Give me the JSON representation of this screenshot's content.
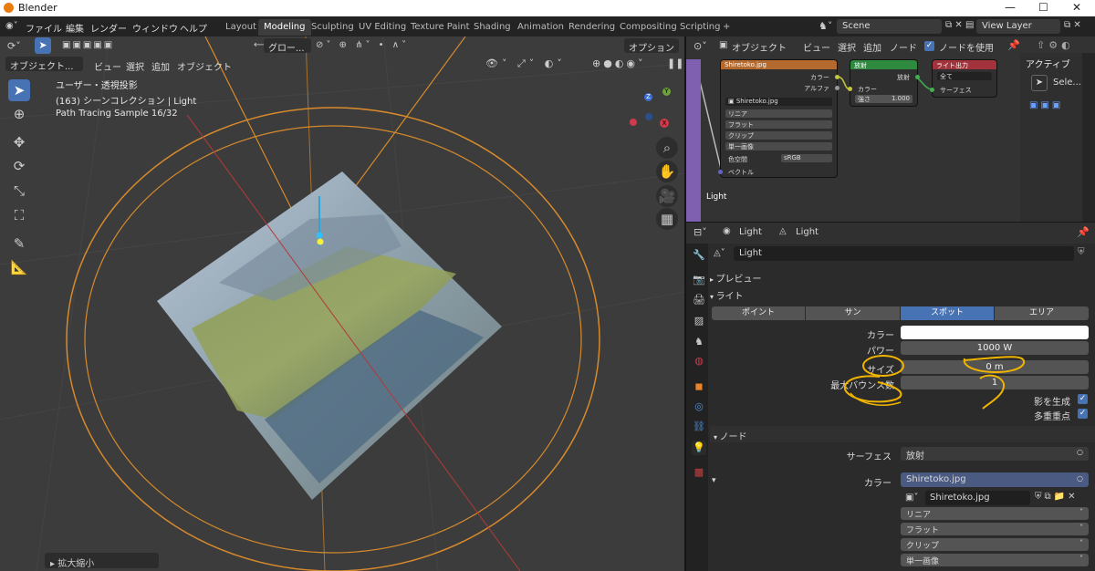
{
  "window": {
    "title": "Blender",
    "min": "—",
    "max": "☐",
    "close": "✕"
  },
  "menu": [
    "ファイル",
    "編集",
    "レンダー",
    "ウィンドウ",
    "ヘルプ"
  ],
  "workspaces": [
    "Layout",
    "Modeling",
    "Sculpting",
    "UV Editing",
    "Texture Paint",
    "Shading",
    "Animation",
    "Rendering",
    "Compositing",
    "Scripting",
    "+"
  ],
  "scene": "Scene",
  "view_layer": "View Layer",
  "viewport": {
    "header_global": "グロー...",
    "options": "オプション",
    "mode": "オブジェクト...",
    "menus": [
      "ビュー",
      "選択",
      "追加",
      "オブジェクト"
    ],
    "info_line1": "ユーザー・透視投影",
    "info_line2": "(163) シーンコレクション | Light",
    "info_line3": "Path Tracing Sample 16/32",
    "status_zoom": "拡大縮小",
    "gizmo": {
      "z": "Z",
      "y": "Y",
      "x": "X"
    }
  },
  "node_editor": {
    "mode": "オブジェクト",
    "menus": [
      "ビュー",
      "選択",
      "追加",
      "ノード"
    ],
    "use_nodes": "ノードを使用",
    "label": "Light",
    "image_node": {
      "title": "Shiretoko.jpg",
      "out_color": "カラー",
      "out_alpha": "アルファ",
      "file": "Shiretoko.jpg",
      "dropdowns": [
        "リニア",
        "フラット",
        "クリップ",
        "単一画像"
      ],
      "colorspace_label": "色空間",
      "colorspace": "sRGB",
      "vector": "ベクトル"
    },
    "emission_node": {
      "title": "放射",
      "out": "放射",
      "in_color": "カラー",
      "strength_label": "強さ",
      "strength": "1.000"
    },
    "output_node": {
      "title": "ライト出力",
      "target": "全て",
      "surface": "サーフェス"
    },
    "side_tab": "アクティブ",
    "side_select": "Sele..."
  },
  "properties": {
    "breadcrumb": [
      "Light",
      "Light"
    ],
    "data_name": "Light",
    "preview": "プレビュー",
    "light_section": "ライト",
    "types": [
      "ポイント",
      "サン",
      "スポット",
      "エリア"
    ],
    "active_type": "スポット",
    "color_label": "カラー",
    "color_value": "#ffffff",
    "power_label": "パワー",
    "power": "1000 W",
    "size_label": "サイズ",
    "size": "0 m",
    "bounce_label": "最大バウンス数",
    "bounce": "1",
    "shadow": "影を生成",
    "mis": "多重重点",
    "nodes_section": "ノード",
    "surface_label": "サーフェス",
    "surface": "放射",
    "color2_label": "カラー",
    "color_image": "Shiretoko.jpg",
    "image_file": "Shiretoko.jpg",
    "interp": [
      "リニア",
      "フラット",
      "クリップ",
      "単一画像"
    ]
  },
  "colors": {
    "accent": "#4772b3",
    "annotation": "#f0b400",
    "light_outline": "#d68a2c",
    "axis_red": "#b33a3a",
    "active_tab": "#4772b3"
  }
}
